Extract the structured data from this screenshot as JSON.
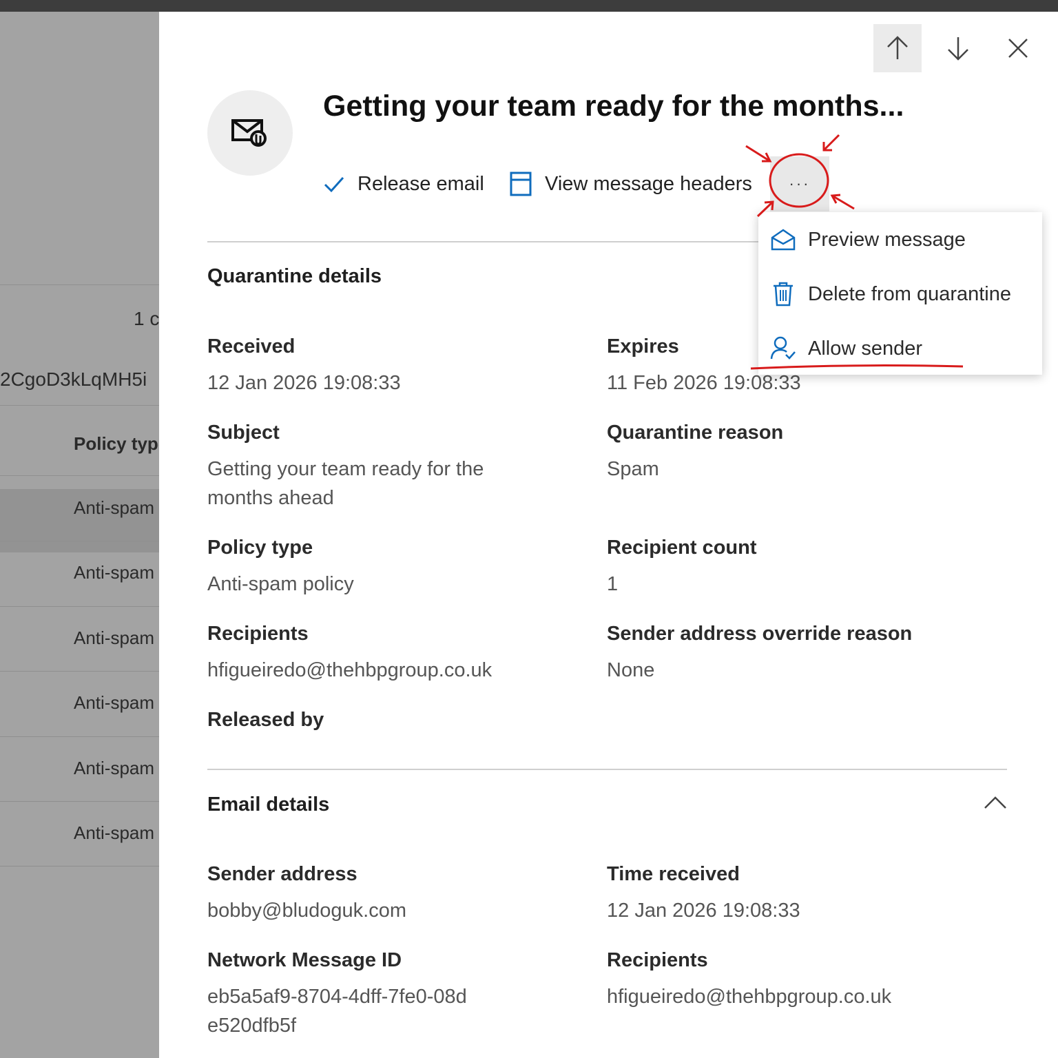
{
  "background": {
    "partial_count": "1 c",
    "partial_id": "2CgoD3kLqMH5i",
    "column_header": "Policy type",
    "rows": [
      "Anti-spam",
      "Anti-spam",
      "Anti-spam",
      "Anti-spam",
      "Anti-spam",
      "Anti-spam"
    ]
  },
  "panel": {
    "title": "Getting your team ready for the months...",
    "commands": {
      "release": "Release email",
      "headers": "View message headers",
      "more": "···"
    },
    "menu": {
      "preview": "Preview message",
      "delete": "Delete from quarantine",
      "allow": "Allow sender"
    },
    "quarantine": {
      "heading": "Quarantine details",
      "received_label": "Received",
      "received_value": "12 Jan 2026 19:08:33",
      "expires_label": "Expires",
      "expires_value": "11 Feb 2026 19:08:33",
      "subject_label": "Subject",
      "subject_value": "Getting your team ready for the months ahead",
      "reason_label": "Quarantine reason",
      "reason_value": "Spam",
      "policy_label": "Policy type",
      "policy_value": "Anti-spam policy",
      "count_label": "Recipient count",
      "count_value": "1",
      "recipients_label": "Recipients",
      "recipients_value": "hfigueiredo@thehbpgroup.co.uk",
      "override_label": "Sender address override reason",
      "override_value": "None",
      "released_label": "Released by"
    },
    "email": {
      "heading": "Email details",
      "sender_label": "Sender address",
      "sender_value": "bobby@bludoguk.com",
      "time_label": "Time received",
      "time_value": "12 Jan 2026 19:08:33",
      "netid_label": "Network Message ID",
      "netid_value": "eb5a5af9-8704-4dff-7fe0-08de520dfb5f",
      "recipients_label": "Recipients",
      "recipients_value": "hfigueiredo@thehbpgroup.co.uk"
    }
  },
  "colors": {
    "accent": "#0f6cbd",
    "annotation": "#d81b1b",
    "overlay": "#9e9e9e"
  }
}
